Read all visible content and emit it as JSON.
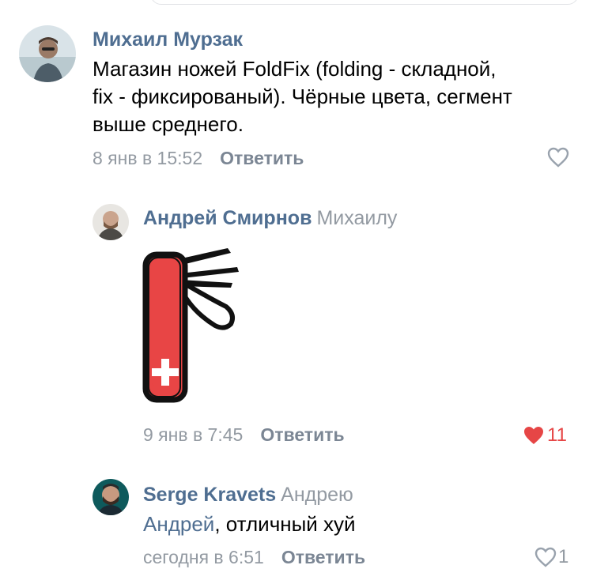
{
  "comments": [
    {
      "author": "Михаил Мурзак",
      "reply_to": "",
      "text_lines": [
        "Магазин ножей FoldFix (folding - складной,",
        "fix - фиксированый). Чёрные цвета, сегмент",
        "выше среднего."
      ],
      "time": "8 янв в 15:52",
      "reply_label": "Ответить",
      "likes": "",
      "liked": false
    },
    {
      "author": "Андрей Смирнов",
      "reply_to": "Михаилу",
      "time": "9 янв в 7:45",
      "reply_label": "Ответить",
      "likes": "11",
      "liked": true
    },
    {
      "author": "Serge Kravets",
      "reply_to": "Андрею",
      "mention": "Андрей",
      "text": ", отличный хуй",
      "time": "сегодня в 6:51",
      "reply_label": "Ответить",
      "likes": "1",
      "liked": false
    }
  ],
  "colors": {
    "link": "#4f6e91",
    "muted": "#939aa2",
    "like_active": "#e64646",
    "knife_red": "#e84545"
  },
  "icons": {
    "like": "heart-icon"
  }
}
